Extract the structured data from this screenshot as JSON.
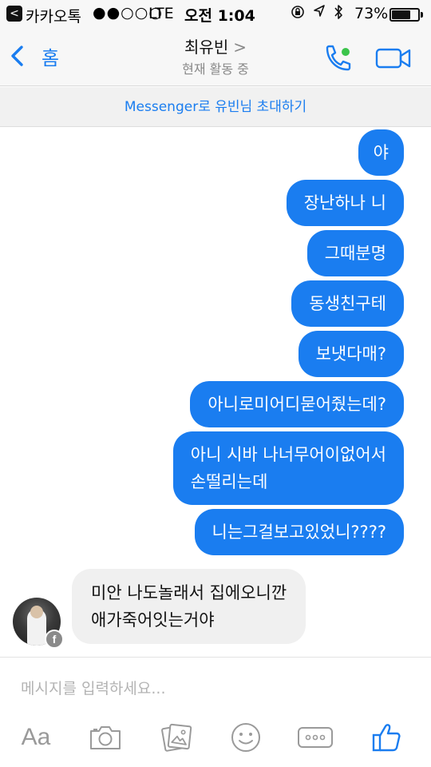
{
  "status_bar": {
    "back_glyph": "<",
    "app_name": "카카오톡",
    "signal": "●●○○○",
    "carrier": "LTE",
    "time": "오전 1:04",
    "battery_text": "73%",
    "battery_level": 0.73
  },
  "header": {
    "back_label": "홈",
    "contact_name": "최유빈",
    "chevron": ">",
    "status": "현재 활동 중"
  },
  "invite_banner": "Messenger로 유빈님 초대하기",
  "messages": [
    {
      "from": "me",
      "lines": [
        "야"
      ]
    },
    {
      "from": "me",
      "lines": [
        "장난하나 니"
      ]
    },
    {
      "from": "me",
      "lines": [
        "그때분명"
      ]
    },
    {
      "from": "me",
      "lines": [
        "동생친구테"
      ]
    },
    {
      "from": "me",
      "lines": [
        "보냇다매?"
      ]
    },
    {
      "from": "me",
      "lines": [
        "아니로미어디묻어줬는데?"
      ]
    },
    {
      "from": "me",
      "lines": [
        "아니 시바 나너무어이없어서",
        "손떨리는데"
      ]
    },
    {
      "from": "me",
      "lines": [
        "니는그걸보고있었니????"
      ]
    },
    {
      "from": "them",
      "lines": [
        "미안 나도놀래서 집에오니깐",
        "애가죽어잇는거야"
      ]
    }
  ],
  "fb_badge": "f",
  "composer": {
    "placeholder": "메시지를 입력하세요...",
    "text_tool_label": "Aa"
  },
  "colors": {
    "accent": "#1a7df0",
    "incoming_bubble": "#f0f0f0",
    "online": "#3bc44b"
  },
  "icons": [
    "chevron-left-icon",
    "phone-icon",
    "video-camera-icon",
    "camera-icon",
    "gallery-icon",
    "emoji-icon",
    "more-icon",
    "thumbs-up-icon",
    "facebook-icon"
  ]
}
